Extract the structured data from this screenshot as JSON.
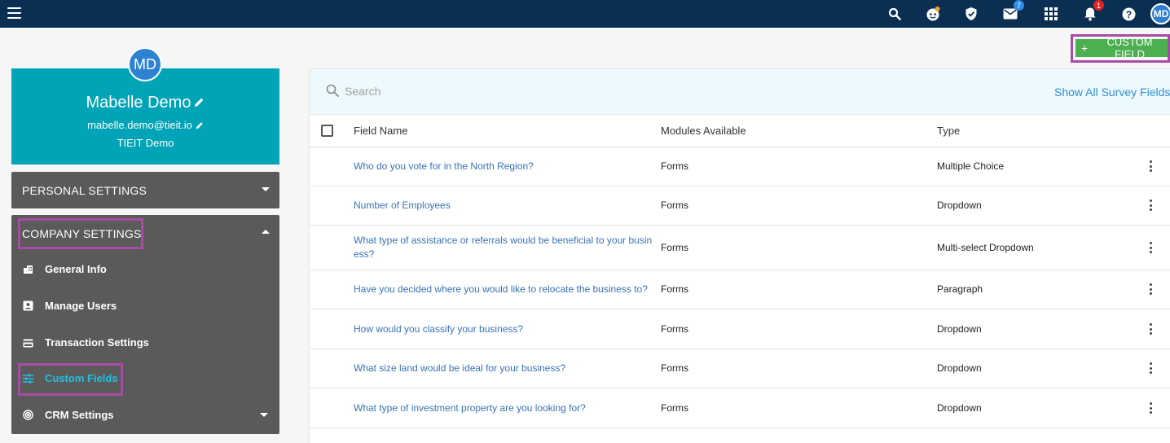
{
  "topbar": {
    "icons": [
      "menu-icon",
      "search-icon",
      "bot-icon",
      "shield-icon",
      "mail-icon",
      "apps-grid-icon",
      "bell-icon",
      "help-icon"
    ],
    "mail_badge": "7",
    "notification_badge": "1",
    "user_initials": "MD",
    "color": "#0b2f52"
  },
  "profile": {
    "initials": "MD",
    "name": "Mabelle Demo",
    "email": "mabelle.demo@tieit.io",
    "company": "TIEIT Demo",
    "card_color": "#00a4b6"
  },
  "sidebar": {
    "personal_settings": "PERSONAL SETTINGS",
    "company_settings": "COMPANY SETTINGS",
    "items": [
      {
        "label": "General Info",
        "icon": "building-icon"
      },
      {
        "label": "Manage Users",
        "icon": "user-card-icon"
      },
      {
        "label": "Transaction Settings",
        "icon": "credit-card-icon"
      },
      {
        "label": "Custom Fields",
        "icon": "sliders-icon",
        "active": true
      },
      {
        "label": "CRM Settings",
        "icon": "target-icon"
      }
    ],
    "active_color": "#1fc1e6"
  },
  "actions": {
    "add_custom_field": "CUSTOM FIELD",
    "plus": "+"
  },
  "search": {
    "placeholder": "Search",
    "show_all_link": "Show All Survey Fields"
  },
  "table": {
    "headers": {
      "field_name": "Field Name",
      "modules": "Modules Available",
      "type": "Type"
    },
    "rows": [
      {
        "name": "Who do you vote for in the North Region?",
        "modules": "Forms",
        "type": "Multiple Choice"
      },
      {
        "name": "Number of Employees",
        "modules": "Forms",
        "type": "Dropdown"
      },
      {
        "name": "What type of assistance or referrals would be beneficial to your business?",
        "modules": "Forms",
        "type": "Multi-select Dropdown"
      },
      {
        "name": "Have you decided where you would like to relocate the business to?",
        "modules": "Forms",
        "type": "Paragraph"
      },
      {
        "name": "How would you classify your business?",
        "modules": "Forms",
        "type": "Dropdown"
      },
      {
        "name": "What size land would be ideal for your business?",
        "modules": "Forms",
        "type": "Dropdown"
      },
      {
        "name": "What type of investment property are you looking for?",
        "modules": "Forms",
        "type": "Dropdown"
      }
    ]
  },
  "colors": {
    "link": "#3a72b8",
    "button_green": "#4caf50",
    "highlight_purple": "#a64ca6"
  }
}
